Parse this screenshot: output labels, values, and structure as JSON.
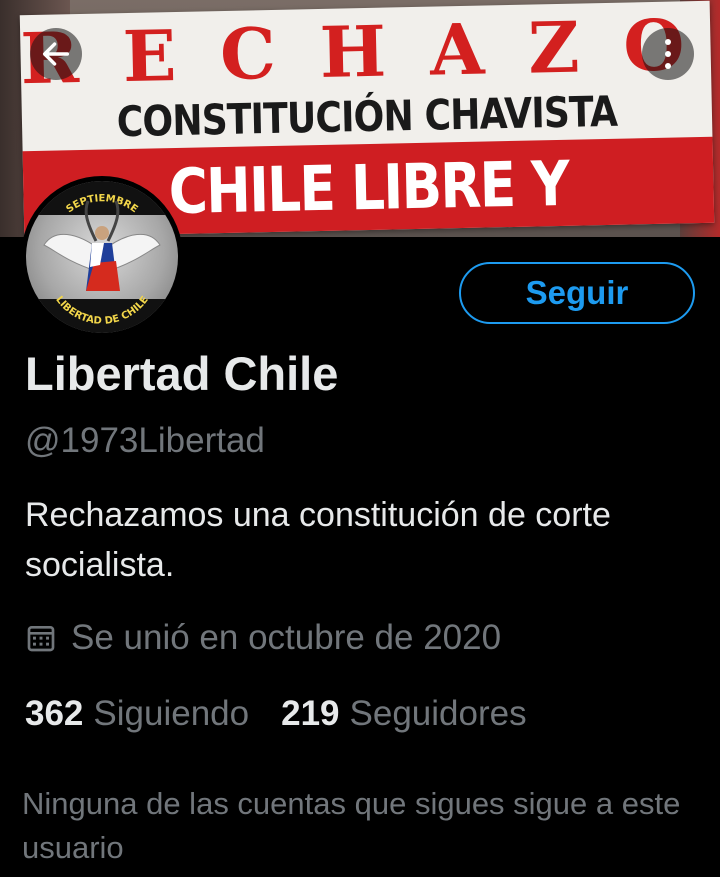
{
  "banner": {
    "line1": "RECHAZO",
    "line2": "CONSTITUCIÓN CHAVISTA",
    "line3": "CHILE LIBRE Y SOBERANO",
    "colors": {
      "red": "#cf1e22",
      "cloth": "#f1efeb"
    }
  },
  "nav": {
    "back_icon": "arrow-left-icon",
    "more_icon": "more-vertical-icon"
  },
  "avatar": {
    "top_text": "SEPTIEMBRE",
    "bottom_text": "LIBERTAD DE CHILE"
  },
  "follow_button": {
    "label": "Seguir",
    "color": "#1d9bf0"
  },
  "profile": {
    "name": "Libertad Chile",
    "handle": "@1973Libertad",
    "bio": "Rechazamos una constitución de corte socialista.",
    "joined": "Se unió en octubre de 2020",
    "joined_icon": "calendar-icon"
  },
  "stats": {
    "following_count": "362",
    "following_label": "Siguiendo",
    "followers_count": "219",
    "followers_label": "Seguidores"
  },
  "notice": "Ninguna de las cuentas que sigues sigue a este usuario"
}
